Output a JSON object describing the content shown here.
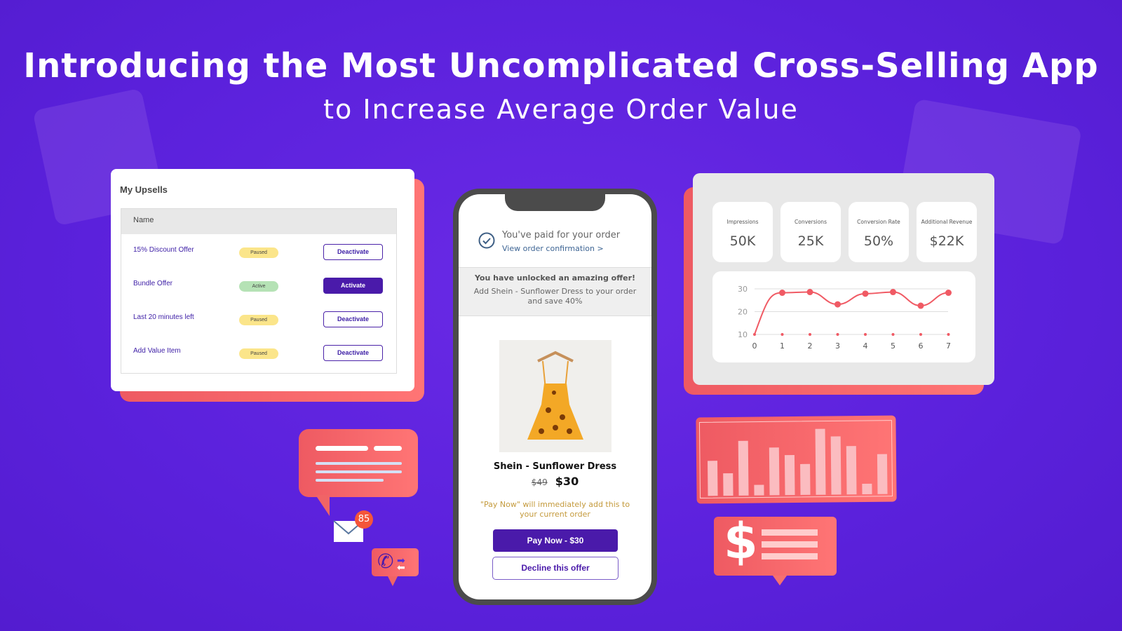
{
  "headline": {
    "line1": "Introducing the Most Uncomplicated Cross-Selling App",
    "line2": "to Increase Average Order Value"
  },
  "upsells": {
    "title": "My Upsells",
    "column": "Name",
    "rows": [
      {
        "name": "15% Discount Offer",
        "status": "Paused",
        "action": "Deactivate",
        "active": false
      },
      {
        "name": "Bundle Offer",
        "status": "Active",
        "action": "Activate",
        "active": true
      },
      {
        "name": "Last 20 minutes left",
        "status": "Paused",
        "action": "Deactivate",
        "active": false
      },
      {
        "name": "Add Value Item",
        "status": "Paused",
        "action": "Deactivate",
        "active": false
      }
    ]
  },
  "phone": {
    "paid": "You've paid for your order",
    "confirm_link": "View order confirmation >",
    "offer_title": "You have unlocked an amazing offer!",
    "offer_text": "Add Shein - Sunflower Dress to your order and save 40%",
    "product": "Shein - Sunflower Dress",
    "old_price": "$49",
    "price": "$30",
    "note": "\"Pay Now\" will immediately add this to your current order",
    "pay_button": "Pay Now - $30",
    "decline_button": "Decline this offer"
  },
  "stats": [
    {
      "label": "Impressions",
      "value": "50K"
    },
    {
      "label": "Conversions",
      "value": "25K"
    },
    {
      "label": "Conversion Rate",
      "value": "50%"
    },
    {
      "label": "Additional Revenue",
      "value": "$22K"
    }
  ],
  "chart_data": {
    "type": "line",
    "x": [
      0,
      1,
      2,
      3,
      4,
      5,
      6,
      7
    ],
    "values": [
      10,
      28.3,
      28.6,
      23.2,
      27.9,
      28.6,
      22.6,
      28.3
    ],
    "yticks": [
      10,
      20,
      30
    ],
    "ylim": [
      10,
      30
    ],
    "grid": true,
    "color": "#f05a64"
  },
  "badge_count": "85",
  "colors": {
    "background": "#5b21dc",
    "accent": "#4a1aaa",
    "coral": "#f26a6d"
  }
}
